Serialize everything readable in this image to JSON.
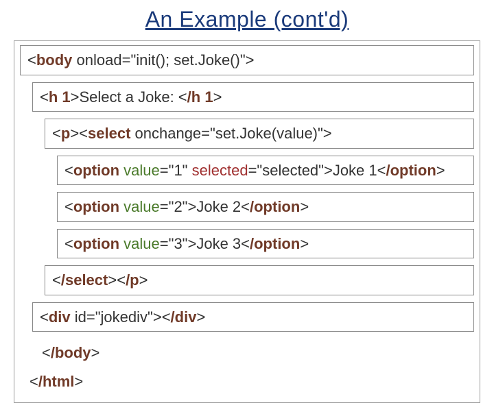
{
  "title": "An Example (cont'd)",
  "rows": {
    "body_open_pre": "<",
    "body_open_tag": "body",
    "body_open_after": " onload=\"init(); set.Joke()\">",
    "h1_pre": "<",
    "h1_tag1": "h 1",
    "h1_text": ">Select a  Joke: <",
    "h1_tag2": "/h 1",
    "h1_post": ">",
    "sel_pre": "<",
    "sel_p": "p",
    "sel_mid1": "><",
    "sel_select": "select",
    "sel_onchange": " onchange=\"set.Joke(value)\">",
    "opt1_pre": "<",
    "opt1_tag": "option",
    "opt1_valword": " value",
    "opt1_valpart": "=\"1\" ",
    "opt1_selword": "selected",
    "opt1_selpart": "=\"selected\">Joke 1<",
    "opt1_close": "/option",
    "opt1_post": ">",
    "opt2_pre": "<",
    "opt2_tag": "option",
    "opt2_valword": " value",
    "opt2_valpart": "=\"2\">Joke 2<",
    "opt2_close": "/option",
    "opt2_post": ">",
    "opt3_pre": "<",
    "opt3_tag": "option",
    "opt3_valword": " value",
    "opt3_valpart": "=\"3\">Joke 3<",
    "opt3_close": "/option",
    "opt3_post": ">",
    "selclose_pre": "<",
    "selclose_select": "/select",
    "selclose_mid": "><",
    "selclose_p": "/p",
    "selclose_post": ">",
    "div_pre": "<",
    "div_tag": "div",
    "div_text": " id=\"jokediv\"><",
    "div_close": "/div",
    "div_post": ">",
    "body_close_pre": "<",
    "body_close": "/body",
    "body_close_post": ">",
    "html_close_pre": "<",
    "html_close": "/html",
    "html_close_post": ">"
  }
}
